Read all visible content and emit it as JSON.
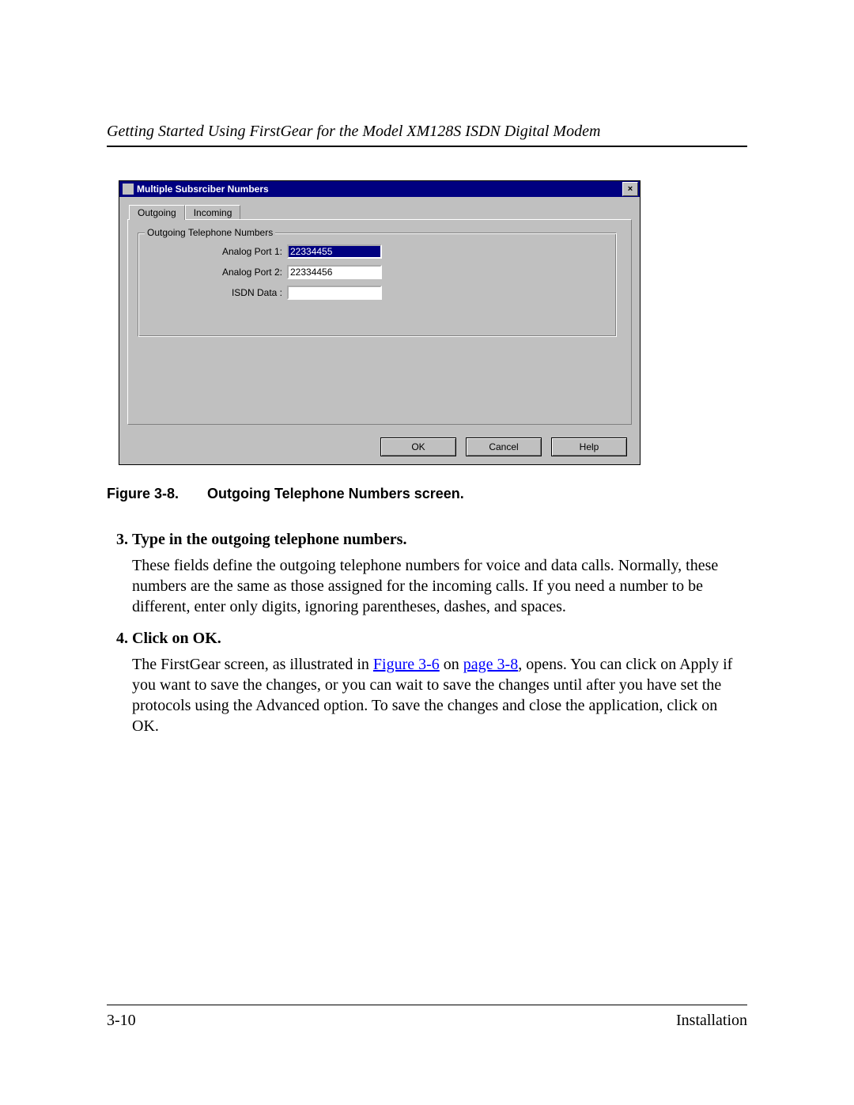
{
  "header": {
    "title": "Getting Started Using FirstGear for the Model XM128S ISDN Digital Modem"
  },
  "dialog": {
    "title": "Multiple Subsrciber Numbers",
    "close_glyph": "×",
    "tabs": {
      "outgoing": "Outgoing",
      "incoming": "Incoming"
    },
    "group_legend": "Outgoing Telephone Numbers",
    "fields": {
      "analog_port_1": {
        "label": "Analog Port 1:",
        "value": "22334455"
      },
      "analog_port_2": {
        "label": "Analog Port 2:",
        "value": "22334456"
      },
      "isdn_data": {
        "label": "ISDN Data :",
        "value": ""
      }
    },
    "buttons": {
      "ok": "OK",
      "cancel": "Cancel",
      "help": "Help"
    }
  },
  "figure": {
    "number": "Figure 3-8.",
    "caption": "Outgoing Telephone Numbers screen."
  },
  "steps": [
    {
      "heading": "Type in the outgoing telephone numbers.",
      "body_plain": "These fields define the outgoing telephone numbers for voice and data calls. Normally, these numbers are the same as those assigned for the incoming calls. If you need a number to be different, enter only digits, ignoring parentheses, dashes, and spaces."
    },
    {
      "heading": "Click on OK.",
      "body_pre_link": "The FirstGear screen, as illustrated in ",
      "link1_text": "Figure 3-6",
      "link_mid": " on ",
      "link2_text": "page 3-8",
      "body_post_link": ", opens. You can click on Apply if you want to save the changes, or you can wait to save the changes until after you have set the protocols using the Advanced option. To save the changes and close the application, click on OK."
    }
  ],
  "footer": {
    "page_number": "3-10",
    "section": "Installation"
  }
}
